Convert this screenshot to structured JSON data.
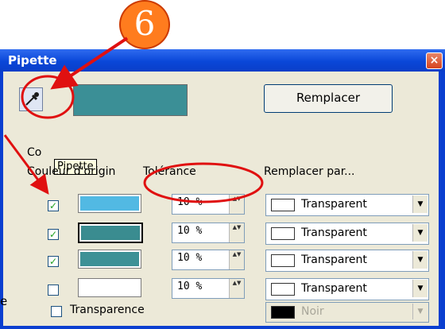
{
  "callout": {
    "number": "6"
  },
  "dialog": {
    "title": "Pipette",
    "close_glyph": "×",
    "pipette_tooltip": "Pipette",
    "replace_button": "Remplacer",
    "colors_section_partial": "Co",
    "col_source": "Couleur d'origin",
    "col_tolerance": "Tolérance",
    "col_replace_with": "Remplacer par...",
    "rows": [
      {
        "checked": true,
        "source_color": "#52b9e3",
        "tolerance": "10 %",
        "replacement": "Transparent"
      },
      {
        "checked": true,
        "source_color": "#3a8c90",
        "tolerance": "10 %",
        "replacement": "Transparent"
      },
      {
        "checked": true,
        "source_color": "#3d9196",
        "tolerance": "10 %",
        "replacement": "Transparent"
      },
      {
        "checked": false,
        "source_color": "#ffffff",
        "tolerance": "10 %",
        "replacement": "Transparent"
      }
    ],
    "transparency_label": "Transparence",
    "transparency_checked": false,
    "transparency_color_label": "Noir",
    "check_glyph": "✓",
    "spin_glyph": "▲▼",
    "drop_glyph": "▼"
  },
  "fragments": {
    "left_edge_partial": "e"
  },
  "colors": {
    "annotation_red": "#e01010",
    "badge_orange": "#ff7c1e",
    "preview_color": "#3b8f96"
  },
  "icons": {
    "eyedropper": "eyedropper-icon",
    "close": "close-icon"
  }
}
